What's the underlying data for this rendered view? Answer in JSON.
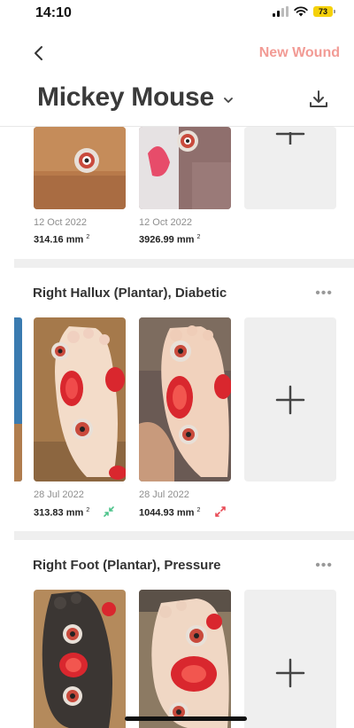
{
  "status_bar": {
    "time": "14:10",
    "battery": "73"
  },
  "nav": {
    "new_wound_label": "New Wound"
  },
  "patient": {
    "name": "Mickey Mouse"
  },
  "wounds": [
    {
      "title": "",
      "images": [
        {
          "date": "12 Oct 2022",
          "area": "314.16 mm",
          "unit_sup": "2"
        },
        {
          "date": "12 Oct 2022",
          "area": "3926.99 mm",
          "unit_sup": "2"
        }
      ]
    },
    {
      "title": "Right Hallux (Plantar), Diabetic",
      "more_label": "•••",
      "images": [
        {
          "date": "28 Jul 2022",
          "area": "313.83 mm",
          "unit_sup": "2",
          "trend": "shrinking",
          "trend_color": "#4cc38a"
        },
        {
          "date": "28 Jul 2022",
          "area": "1044.93 mm",
          "unit_sup": "2",
          "trend": "growing",
          "trend_color": "#e84a55"
        }
      ]
    },
    {
      "title": "Right Foot (Plantar), Pressure",
      "more_label": "•••",
      "images": []
    }
  ],
  "colors": {
    "accent": "#f29b95",
    "divider": "#efefef",
    "add_tile": "#efefef"
  }
}
